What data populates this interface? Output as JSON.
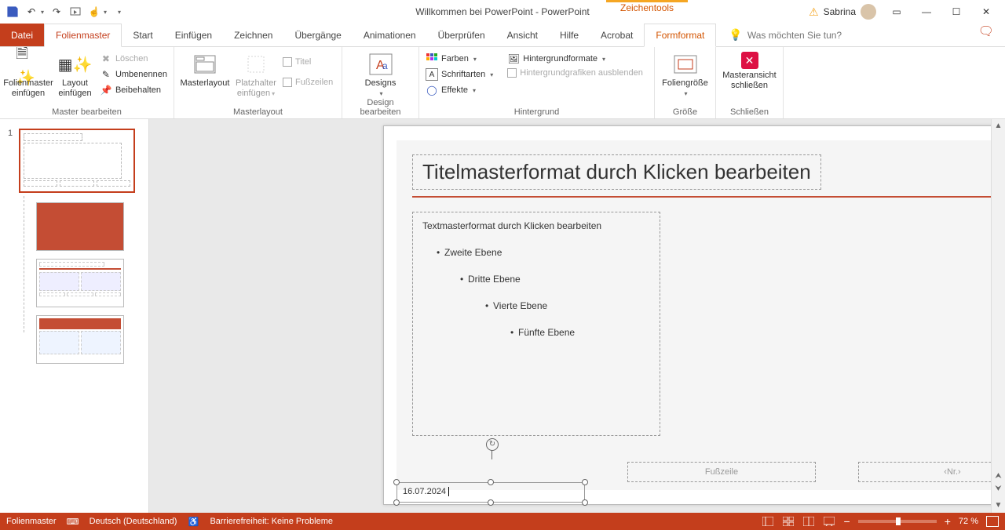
{
  "titlebar": {
    "title": "Willkommen bei PowerPoint  -  PowerPoint",
    "contextual_group": "Zeichentools",
    "user_name": "Sabrina"
  },
  "tabs": {
    "file": "Datei",
    "items": [
      "Folienmaster",
      "Start",
      "Einfügen",
      "Zeichnen",
      "Übergänge",
      "Animationen",
      "Überprüfen",
      "Ansicht",
      "Hilfe",
      "Acrobat",
      "Formformat"
    ],
    "tell_me_placeholder": "Was möchten Sie tun?"
  },
  "ribbon": {
    "group1": {
      "label": "Master bearbeiten",
      "insert_master": "Folienmaster einfügen",
      "insert_layout": "Layout einfügen",
      "delete": "Löschen",
      "rename": "Umbenennen",
      "preserve": "Beibehalten"
    },
    "group2": {
      "label": "Masterlayout",
      "master_layout": "Masterlayout",
      "insert_placeholder": "Platzhalter einfügen",
      "title_cb": "Titel",
      "footer_cb": "Fußzeilen"
    },
    "group3": {
      "label": "Design bearbeiten",
      "designs": "Designs"
    },
    "group4": {
      "label": "Hintergrund",
      "colors": "Farben",
      "fonts": "Schriftarten",
      "effects": "Effekte",
      "bg_formats": "Hintergrundformate",
      "hide_bg": "Hintergrundgrafiken ausblenden"
    },
    "group5": {
      "label": "Größe",
      "slide_size": "Foliengröße"
    },
    "group6": {
      "label": "Schließen",
      "close_master": "Masteransicht schließen"
    }
  },
  "thumbnail": {
    "num": "1"
  },
  "slide": {
    "title_placeholder": "Titelmasterformat durch Klicken bearbeiten",
    "body_l1": "Textmasterformat durch Klicken bearbeiten",
    "body_l2": "Zweite Ebene",
    "body_l3": "Dritte Ebene",
    "body_l4": "Vierte Ebene",
    "body_l5": "Fünfte Ebene",
    "date": "16.07.2024",
    "footer_label": "Fußzeile",
    "slidenum_label": "‹Nr.›"
  },
  "statusbar": {
    "view": "Folienmaster",
    "language": "Deutsch (Deutschland)",
    "accessibility": "Barrierefreiheit: Keine Probleme",
    "zoom": "72 %"
  }
}
